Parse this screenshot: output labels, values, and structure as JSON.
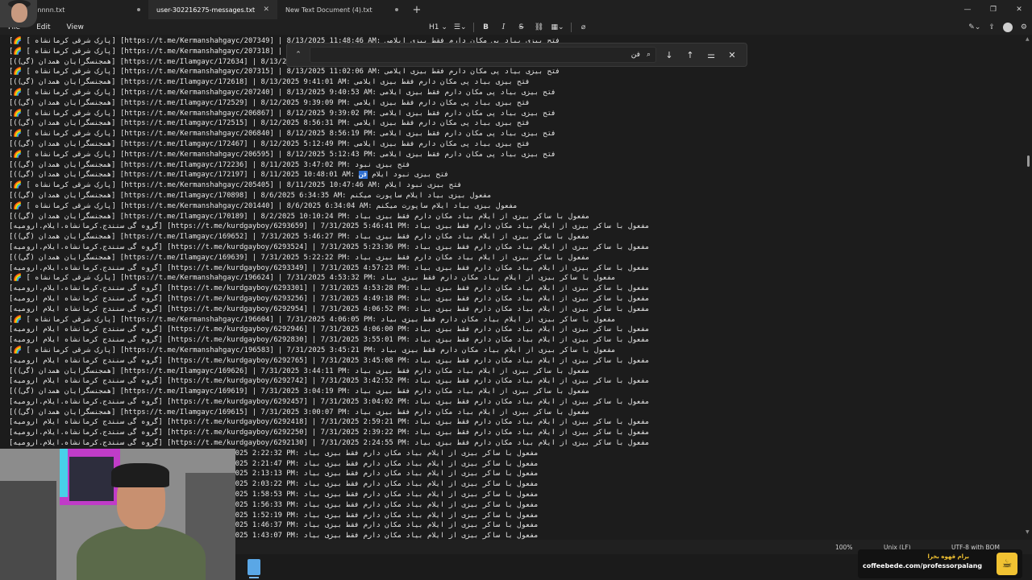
{
  "tabs": [
    {
      "label": "...onnnn.txt",
      "active": false
    },
    {
      "label": "user-302216275-messages.txt",
      "active": true
    },
    {
      "label": "New Text Document (4).txt",
      "active": false
    }
  ],
  "menu": {
    "file": "File",
    "edit": "Edit",
    "view": "View"
  },
  "toolbar": {
    "heading": "H1",
    "bold": "B",
    "italic": "I",
    "strike": "S"
  },
  "find": {
    "query": "فن"
  },
  "editor_lines": [
    "[🌈 [ پارک شرقی کرمانشاه] [https://t.me/Kermanshahgayc/207349] | 8/13/2025 11:48:46 AM: فتح بیزی بیاد پی مکان دارم فقط بیزی ایلامی",
    "[🌈 [ پارک شرقی کرمانشاه] [https://t.me/Kermanshahgayc/207318] | 8/13/2025 11:41:02 AM: فتح بیزی بیاد پی مکان دارم فقط بیزی ایلامی",
    "[(همجنسگرایان همدان (گی)] [https://t.me/Ilamgayc/172634] | 8/13/2025 11:06:38 AM: فتح بیزی بیاد پی مکان دارم فقط بیزی ایلامی",
    "[🌈 [ پارک شرقی کرمانشاه] [https://t.me/Kermanshahgayc/207315] | 8/13/2025 11:02:06 AM: فتح بیزی بیاد پی مکان دارم فقط بیزی ایلامی",
    "[(همجنسگرایان همدان (گی)] [https://t.me/Ilamgayc/172618] | 8/13/2025 9:41:01 AM: فتح بیزی بیاد پی مکان دارم فقط بیزی ایلامی",
    "[🌈 [ پارک شرقی کرمانشاه] [https://t.me/Kermanshahgayc/207240] | 8/13/2025 9:40:53 AM: فتح بیزی بیاد پی مکان دارم فقط بیزی ایلامی",
    "[(همجنسگرایان همدان (گی)] [https://t.me/Ilamgayc/172529] | 8/12/2025 9:39:09 PM: فتح بیزی بیاد پی مکان دارم فقط بیزی ایلامی",
    "[🌈 [ پارک شرقی کرمانشاه] [https://t.me/Kermanshahgayc/206867] | 8/12/2025 9:39:02 PM: فتح بیزی بیاد پی مکان دارم فقط بیزی ایلامی",
    "[(همجنسگرایان همدان (گی)] [https://t.me/Ilamgayc/172515] | 8/12/2025 8:56:31 PM: فتح بیزی بیاد پی مکان دارم فقط بیزی ایلامی",
    "[🌈 [ پارک شرقی کرمانشاه] [https://t.me/Kermanshahgayc/206840] | 8/12/2025 8:56:19 PM: فتح بیزی بیاد پی مکان دارم فقط بیزی ایلامی",
    "[(همجنسگرایان همدان (گی)] [https://t.me/Ilamgayc/172467] | 8/12/2025 5:12:49 PM: فتح بیزی بیاد پی مکان دارم فقط بیزی ایلامی",
    "[🌈 [ پارک شرقی کرمانشاه] [https://t.me/Kermanshahgayc/206595] | 8/12/2025 5:12:43 PM: فتح بیزی بیاد پی مکان دارم فقط بیزی ایلامی",
    "[(همجنسگرایان همدان (گی)] [https://t.me/Ilamgayc/172236] | 8/11/2025 3:47:02 PM: فتح بیزی نبود",
    "[(همجنسگرایان همدان (گی)] [https://t.me/Ilamgayc/172197] | 8/11/2025 10:48:01 AM: فتح بیزی نبود ایلام ",
    "[🌈 [ پارک شرقی کرمانشاه] [https://t.me/Kermanshahgayc/205405] | 8/11/2025 10:47:46 AM: فتح بیزی نبود ایلام",
    "[(همجنسگرایان همدان (گی)] [https://t.me/Ilamgayc/170898] | 8/6/2025 6:34:35 AM: مفعول بیزی بیاد ایلام ساپورت میکنم",
    "[🌈 [ پارک شرقی کرمانشاه] [https://t.me/Kermanshahgayc/201440] | 8/6/2025 6:34:04 AM: مفعول بیزی بیاد ایلام ساپورت میکنم",
    "[(همجنسگرایان همدان (گی)] [https://t.me/Ilamgayc/170189] | 8/2/2025 10:10:24 PM: مفعول با ساکر بیزی از ایلام بیاد مکان دارم فقط بیزی بیاد",
    "[گروه گی سنندج.کرمانشاه.ایلام.ارومیه] [https://t.me/kurdgayboy/6293659] | 7/31/2025 5:46:41 PM: مفعول با ساکر بیزی از ایلام بیاد مکان دارم فقط بیزی بیاد",
    "[(همجنسگرایان همدان (گی)] [https://t.me/Ilamgayc/169652] | 7/31/2025 5:46:27 PM: مفعول با ساکر بیزی از ایلام بیاد مکان دارم فقط بیزی بیاد",
    "[گروه گی سنندج.کرمانشاه.ایلام.ارومیه] [https://t.me/kurdgayboy/6293524] | 7/31/2025 5:23:36 PM: مفعول با ساکر بیزی از ایلام بیاد مکان دارم فقط بیزی بیاد",
    "[(همجنسگرایان همدان (گی)] [https://t.me/Ilamgayc/169639] | 7/31/2025 5:22:22 PM: مفعول با ساکر بیزی از ایلام بیاد مکان دارم فقط بیزی بیاد",
    "[گروه گی سنندج.کرمانشاه.ایلام.ارومیه] [https://t.me/kurdgayboy/6293349] | 7/31/2025 4:57:23 PM: مفعول با ساکر بیزی از ایلام بیاد مکان دارم فقط بیزی بیاد",
    "[🌈 [ پارک شرقی کرمانشاه] [https://t.me/Kermanshahgayc/196624] | 7/31/2025 4:53:32 PM: مفعول با ساکر بیزی از ایلام بیاد مکان دارم فقط بیزی بیاد",
    "[گروه گی سنندج.کرمانشاه.ایلام.ارومیه] [https://t.me/kurdgayboy/6293301] | 7/31/2025 4:53:28 PM: مفعول با ساکر بیزی از ایلام بیاد مکان دارم فقط بیزی بیاد",
    "[گروه گی سنندج کرمانشاه ایلام ارومیه] [https://t.me/kurdgayboy/6293256] | 7/31/2025 4:49:18 PM: مفعول با ساکر بیزی از ایلام بیاد مکان دارم فقط بیزی بیاد",
    "[گروه گی سنندج کرمانشاه ایلام ارومیه] [https://t.me/kurdgayboy/6292954] | 7/31/2025 4:06:52 PM: مفعول با ساکر بیزی از ایلام بیاد مکان دارم فقط بیزی بیاد",
    "[🌈 [ پارک شرقی کرمانشاه] [https://t.me/Kermanshahgayc/196604] | 7/31/2025 4:06:05 PM: مفعول با ساکر بیزی از ایلام بیاد مکان دارم فقط بیزی بیاد",
    "[گروه گی سنندج کرمانشاه ایلام ارومیه] [https://t.me/kurdgayboy/6292946] | 7/31/2025 4:06:00 PM: مفعول با ساکر بیزی از ایلام بیاد مکان دارم فقط بیزی بیاد",
    "[گروه گی سنندج کرمانشاه ایلام ارومیه] [https://t.me/kurdgayboy/6292830] | 7/31/2025 3:55:01 PM: مفعول با ساکر بیزی از ایلام بیاد مکان دارم فقط بیزی بیاد",
    "[🌈 [ پارک شرقی کرمانشاه] [https://t.me/Kermanshahgayc/196583] | 7/31/2025 3:45:21 PM: مفعول با ساکر بیزی از ایلام بیاد مکان دارم فقط بیزی بیاد",
    "[گروه گی سنندج کرمانشاه ایلام ارومیه] [https://t.me/kurdgayboy/6292765] | 7/31/2025 3:45:08 PM: مفعول با ساکر بیزی از ایلام بیاد مکان دارم فقط بیزی بیاد",
    "[(همجنسگرایان همدان (گی)] [https://t.me/Ilamgayc/169626] | 7/31/2025 3:44:11 PM: مفعول با ساکر بیزی از ایلام بیاد مکان دارم فقط بیزی بیاد",
    "[گروه گی سنندج کرمانشاه ایلام ارومیه] [https://t.me/kurdgayboy/6292742] | 7/31/2025 3:42:52 PM: مفعول با ساکر بیزی از ایلام بیاد مکان دارم فقط بیزی بیاد",
    "[(همجنسگرایان همدان (گی)] [https://t.me/Ilamgayc/169619] | 7/31/2025 3:04:19 PM: مفعول با ساکر بیزی از ایلام بیاد مکان دارم فقط بیزی بیاد",
    "[گروه گی سنندج.کرمانشاه.ایلام.ارومیه] [https://t.me/kurdgayboy/6292457] | 7/31/2025 3:04:02 PM: مفعول با ساکر بیزی از ایلام بیاد مکان دارم فقط بیزی بیاد",
    "[(همجنسگرایان همدان (گی)] [https://t.me/Ilamgayc/169615] | 7/31/2025 3:00:07 PM: مفعول با ساکر بیزی از ایلام بیاد مکان دارم فقط بیزی بیاد",
    "[گروه گی سنندج کرمانشاه ایلام ارومیه] [https://t.me/kurdgayboy/6292418] | 7/31/2025 2:59:21 PM: مفعول با ساکر بیزی از ایلام بیاد مکان دارم فقط بیزی بیاد",
    "[گروه گی سنندج.کرمانشاه.ایلام.ارومیه] [https://t.me/kurdgayboy/6292250] | 7/31/2025 2:39:22 PM: مفعول با ساکر بیزی از ایلام بیاد مکان دارم فقط بیزی بیاد",
    "[گروه گی سنندج.کرمانشاه.ایلام.ارومیه] [https://t.me/kurdgayboy/6292130] | 7/31/2025 2:24:55 PM: مفعول با ساکر بیزی از ایلام بیاد مکان دارم فقط بیزی بیاد",
    "                                 oy/6292112] | 7/31/2025 2:22:32 PM: مفعول با ساکر بیزی از ایلام بیاد مکان دارم فقط بیزی بیاد",
    "                                 oy/6292101] | 7/31/2025 2:21:47 PM: مفعول با ساکر بیزی از ایلام بیاد مکان دارم فقط بیزی بیاد",
    "                                 oy/6291997] | 7/31/2025 2:13:13 PM: مفعول با ساکر بیزی از ایلام بیاد مکان دارم فقط بیزی بیاد",
    "                                 oy/6291891] | 7/31/2025 2:03:22 PM: مفعول با ساکر بیزی از ایلام بیاد مکان دارم فقط بیزی بیاد",
    "                                 oy/6291819] | 7/31/2025 1:58:53 PM: مفعول با ساکر بیزی از ایلام بیاد مکان دارم فقط بیزی بیاد",
    "                                 oy/6291788] | 7/31/2025 1:56:33 PM: مفعول با ساکر بیزی از ایلام بیاد مکان دارم فقط بیزی بیاد",
    "                                 oy/6291736] | 7/31/2025 1:52:19 PM: مفعول با ساکر بیزی از ایلام بیاد مکان دارم فقط بیزی بیاد",
    "                                 oy/6291686] | 7/31/2025 1:46:37 PM: مفعول با ساکر بیزی از ایلام بیاد مکان دارم فقط بیزی بیاد",
    "                                 oy/6291668] | 7/31/2025 1:43:07 PM: مفعول با ساکر بیزی از ایلام بیاد مکان دارم فقط بیزی بیاد"
  ],
  "highlight": {
    "line": 13,
    "text": "فن"
  },
  "status": {
    "zoom": "100%",
    "line_ending": "Unix (LF)",
    "encoding": "UTF-8 with BOM"
  },
  "coffee": {
    "title": "برام قهوه بخرا",
    "url": "coffeebede.com/professorpalang"
  },
  "colors": {
    "accent": "#2f6fd0",
    "badge": "#f1c232"
  }
}
